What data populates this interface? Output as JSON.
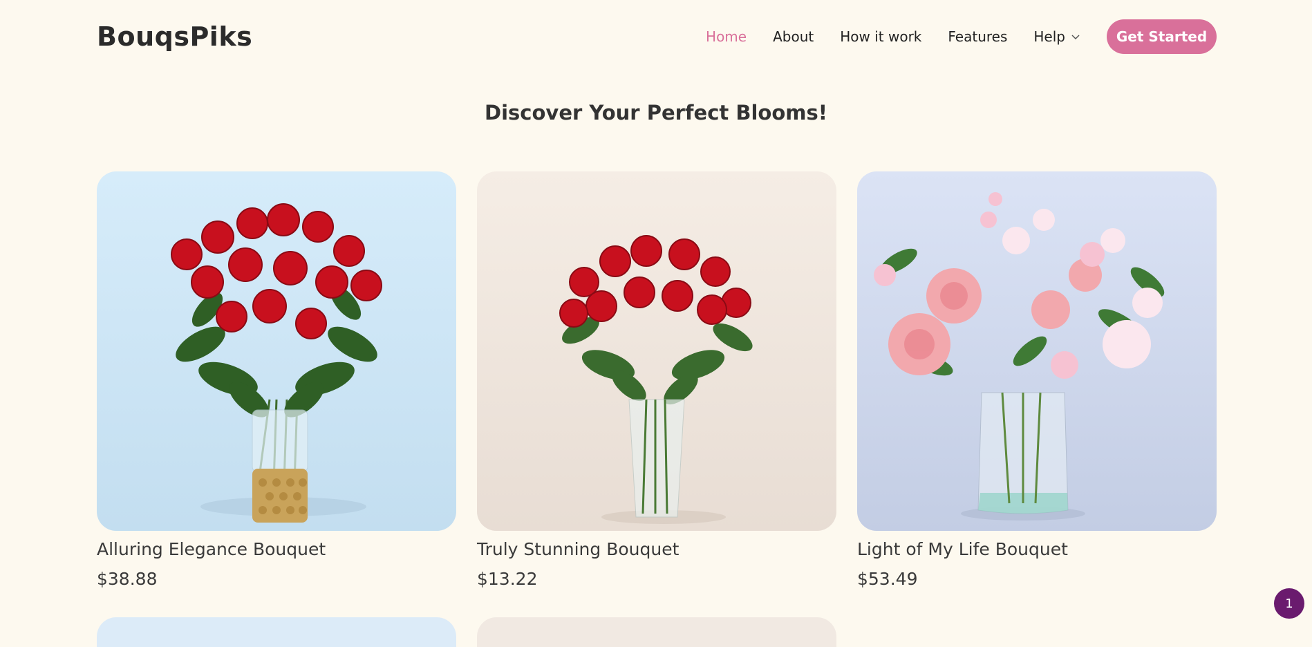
{
  "brand": {
    "name": "BouqsPiks"
  },
  "nav": {
    "items": [
      {
        "label": "Home",
        "active": true
      },
      {
        "label": "About"
      },
      {
        "label": "How it work"
      },
      {
        "label": "Features"
      },
      {
        "label": "Help",
        "icon": "chevron-down-icon"
      }
    ],
    "cta_label": "Get Started"
  },
  "hero": {
    "title": "Discover Your Perfect Blooms!"
  },
  "products": [
    {
      "name": "Alluring Elegance Bouquet",
      "price": "$38.88",
      "bg": "#cfe8f7",
      "image": "red roses in gold vase"
    },
    {
      "name": "Truly Stunning Bouquet",
      "price": "$13.22",
      "bg": "#f1e9e2",
      "image": "red roses in glass vase"
    },
    {
      "name": "Light of My Life Bouquet",
      "price": "$53.49",
      "bg": "#d3dcef",
      "image": "pink and white flowers in glass vase"
    }
  ],
  "next_row_colors": [
    "#dcebf8",
    "#f1e9e2"
  ],
  "badge": {
    "count": "1"
  },
  "colors": {
    "accent": "#d9709a",
    "background": "#fdf9ef",
    "badge": "#6a1b6e"
  }
}
